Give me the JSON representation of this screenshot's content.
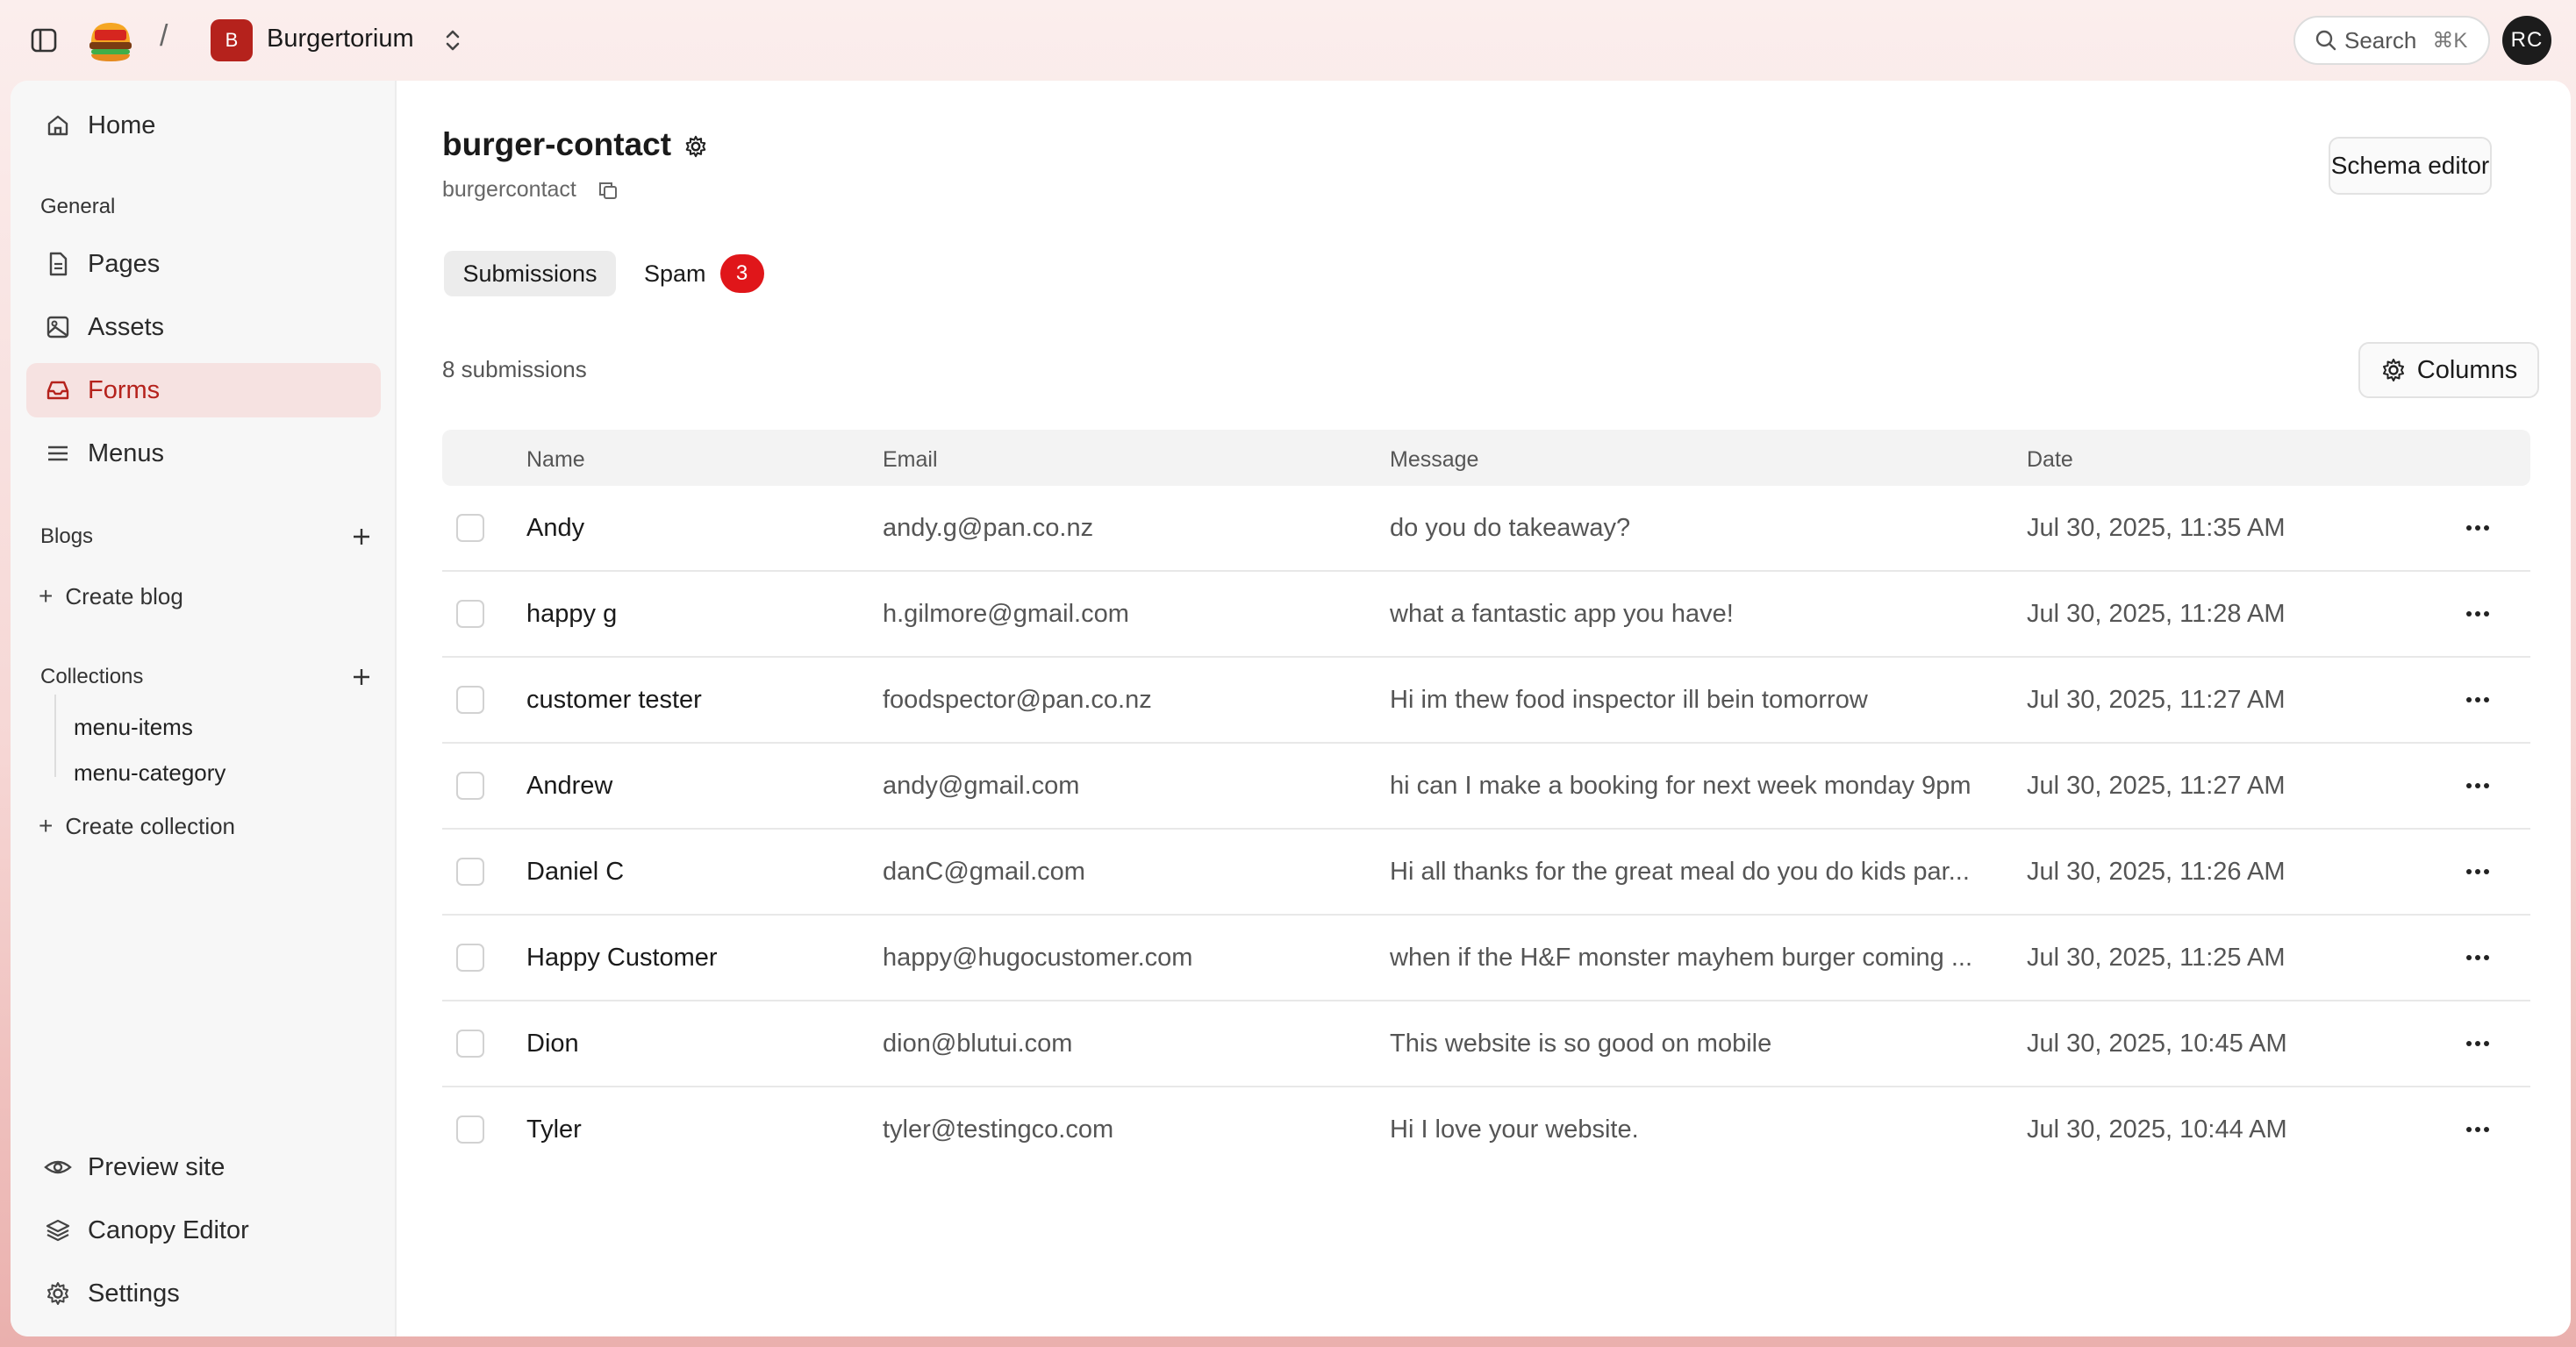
{
  "topbar": {
    "separator": "/",
    "site_badge": "B",
    "site_name": "Burgertorium",
    "search_label": "Search",
    "search_shortcut": "⌘K",
    "avatar_initials": "RC"
  },
  "sidebar": {
    "home": "Home",
    "general_label": "General",
    "general_items": [
      "Pages",
      "Assets",
      "Forms",
      "Menus"
    ],
    "active_item": "Forms",
    "blogs_label": "Blogs",
    "create_blog": "Create blog",
    "collections_label": "Collections",
    "collections": [
      "menu-items",
      "menu-category"
    ],
    "create_collection": "Create collection",
    "bottom_items": [
      "Preview site",
      "Canopy Editor",
      "Settings"
    ]
  },
  "content": {
    "title": "burger-contact",
    "subtitle": "burgercontact",
    "schema_button": "Schema editor",
    "tabs": {
      "submissions": "Submissions",
      "spam": "Spam",
      "spam_count": "3"
    },
    "count_text": "8 submissions",
    "columns_button": "Columns"
  },
  "table": {
    "headers": [
      "Name",
      "Email",
      "Message",
      "Date"
    ],
    "rows": [
      {
        "name": "Andy",
        "email": "andy.g@pan.co.nz",
        "message": "do you do takeaway?",
        "date": "Jul 30, 2025, 11:35 AM"
      },
      {
        "name": "happy g",
        "email": "h.gilmore@gmail.com",
        "message": "what a fantastic app you have!",
        "date": "Jul 30, 2025, 11:28 AM"
      },
      {
        "name": "customer tester",
        "email": "foodspector@pan.co.nz",
        "message": "Hi im thew food inspector ill bein tomorrow",
        "date": "Jul 30, 2025, 11:27 AM"
      },
      {
        "name": "Andrew",
        "email": "andy@gmail.com",
        "message": "hi can I make a booking for next week monday 9pm",
        "date": "Jul 30, 2025, 11:27 AM"
      },
      {
        "name": "Daniel C",
        "email": "danC@gmail.com",
        "message": "Hi all thanks for the great meal do you do kids par...",
        "date": "Jul 30, 2025, 11:26 AM"
      },
      {
        "name": "Happy Customer",
        "email": "happy@hugocustomer.com",
        "message": "when if the H&F monster mayhem burger coming ...",
        "date": "Jul 30, 2025, 11:25 AM"
      },
      {
        "name": "Dion",
        "email": "dion@blutui.com",
        "message": "This website is so good on mobile",
        "date": "Jul 30, 2025, 10:45 AM"
      },
      {
        "name": "Tyler",
        "email": "tyler@testingco.com",
        "message": "Hi I love your website.",
        "date": "Jul 30, 2025, 10:44 AM"
      }
    ]
  },
  "colors": {
    "accent": "#b5221c",
    "active_nav_bg": "#f6e2e1",
    "spam_badge": "#e0161a"
  }
}
